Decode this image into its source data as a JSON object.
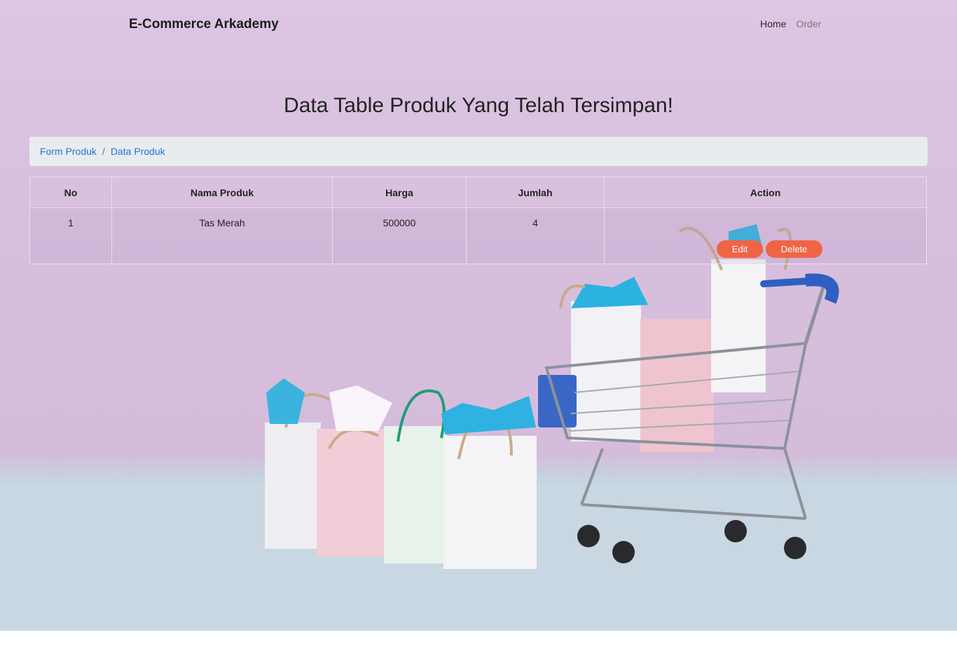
{
  "navbar": {
    "brand": "E-Commerce Arkademy",
    "links": [
      {
        "label": "Home"
      },
      {
        "label": "Order"
      }
    ]
  },
  "page_title": "Data Table Produk Yang Telah Tersimpan!",
  "breadcrumb": [
    {
      "label": "Form Produk"
    },
    {
      "label": "Data Produk"
    }
  ],
  "breadcrumb_separator": "/",
  "table": {
    "headers": [
      "No",
      "Nama Produk",
      "Harga",
      "Jumlah",
      "Action"
    ],
    "rows": [
      {
        "no": "1",
        "nama": "Tas Merah",
        "harga": "500000",
        "jumlah": "4",
        "actions": {
          "edit": "Edit",
          "delete": "Delete"
        }
      }
    ]
  },
  "colors": {
    "background_top": "#dcc6e3",
    "floor": "#c5d4e1",
    "link": "#1e73d8",
    "button": "#ef6445",
    "breadcrumb_bg": "#e9ecef"
  }
}
